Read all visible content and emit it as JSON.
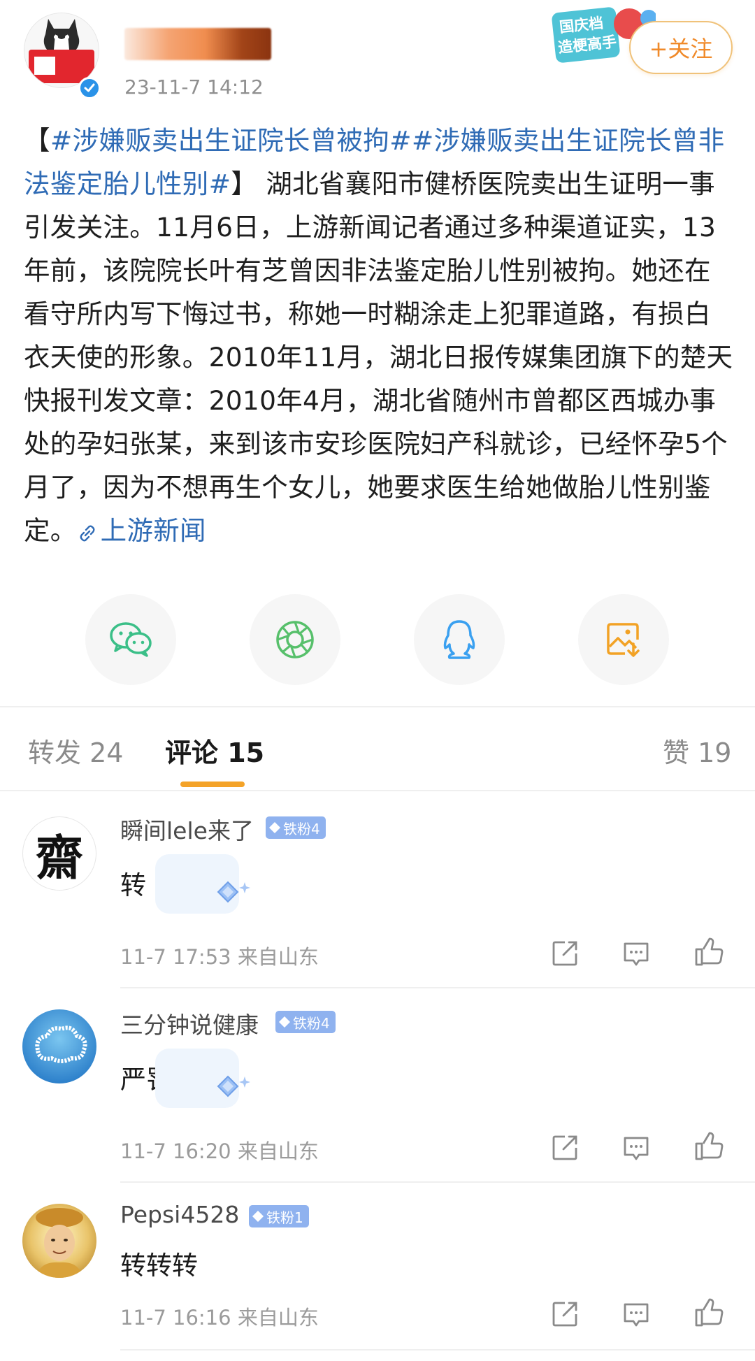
{
  "header": {
    "post_time": "23-11-7 14:12",
    "follow_label": "+关注",
    "promo_line1": "国庆档",
    "promo_line2": "造梗高手"
  },
  "post": {
    "topic1": "#涉嫌贩卖出生证院长曾被拘#",
    "topic2": "#涉嫌贩卖出生证院长曾非法鉴定胎儿性别#",
    "bracket_open": "【",
    "bracket_close": "】",
    "body": "湖北省襄阳市健桥医院卖出生证明一事引发关注。11月6日，上游新闻记者通过多种渠道证实，13年前，该院院长叶有芝曾因非法鉴定胎儿性别被拘。她还在看守所内写下悔过书，称她一时糊涂走上犯罪道路，有损白衣天使的形象。2010年11月，湖北日报传媒集团旗下的楚天快报刊发文章：2010年4月，湖北省随州市曾都区西城办事处的孕妇张某，来到该市安珍医院妇产科就诊，已经怀孕5个月了，因为不想再生个女儿，她要求医生给她做胎儿性别鉴定。",
    "source_link": "上游新闻"
  },
  "share": {
    "icons": [
      "wechat-icon",
      "moments-icon",
      "qq-icon",
      "save-image-icon"
    ]
  },
  "tabs": {
    "repost": "转发 24",
    "comments": "评论 15",
    "likes": "赞 19"
  },
  "colors": {
    "accent_orange": "#f4a328",
    "link_blue": "#2f6bb5",
    "fan_badge": "#8fb2ef"
  },
  "comments": [
    {
      "user": "瞬间lele来了",
      "badge": "铁粉4",
      "avatar_char": "齋",
      "text": "转",
      "time": "11-7 17:53",
      "location": "来自山东"
    },
    {
      "user": "三分钟说健康",
      "badge": "铁粉4",
      "text": "严罚",
      "time": "11-7 16:20",
      "location": "来自山东"
    },
    {
      "user": "Pepsi4528",
      "badge": "铁粉1",
      "text": "转转转",
      "time": "11-7 16:16",
      "location": "来自山东"
    }
  ]
}
